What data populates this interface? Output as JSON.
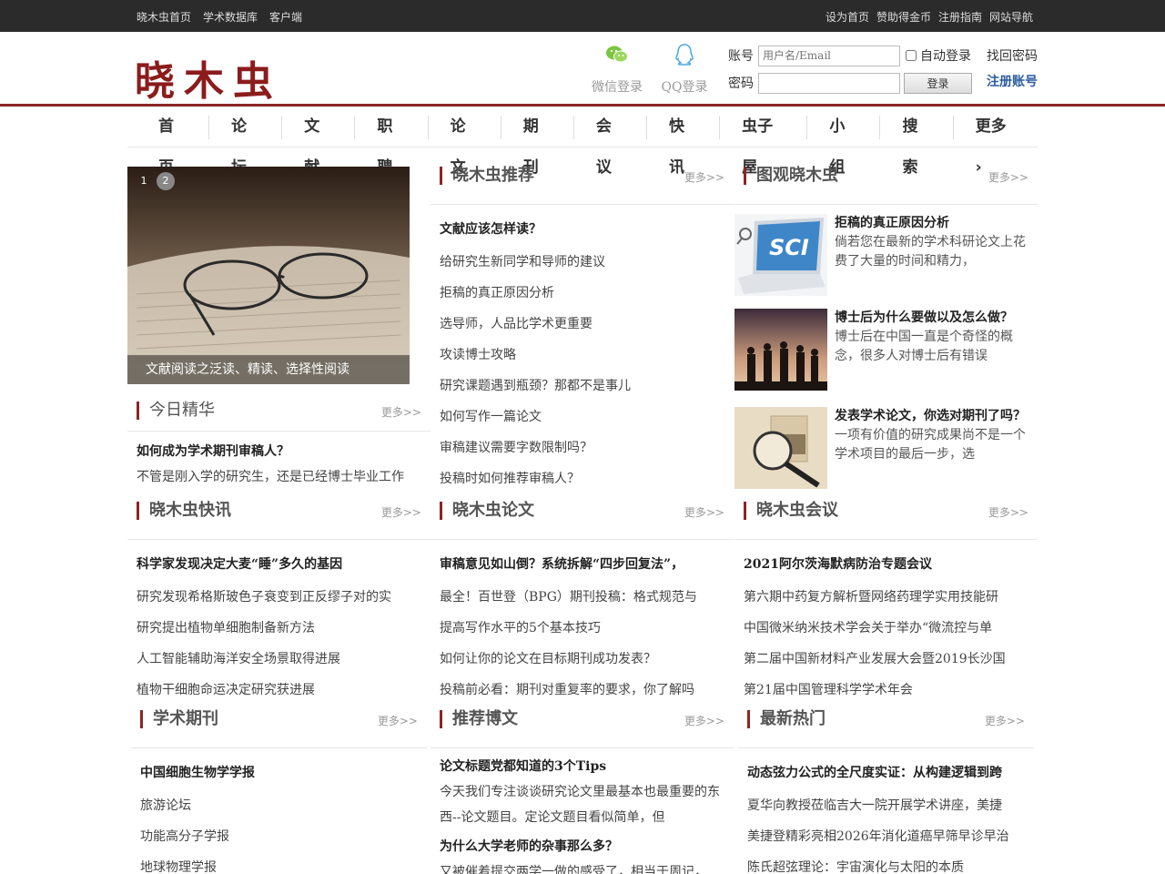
{
  "topbar": {
    "left": [
      "晓木虫首页",
      "学术数据库",
      "客户端"
    ],
    "right": [
      "设为首页",
      "赞助得金币",
      "注册指南",
      "网站导航"
    ]
  },
  "header": {
    "logo": "晓木虫",
    "wechat_label": "微信登录",
    "qq_label": "QQ登录",
    "account_label": "账号",
    "account_placeholder": "用户名/Email",
    "password_label": "密码",
    "auto_login": "自动登录",
    "login_button": "登录",
    "find_password": "找回密码",
    "register": "注册账号"
  },
  "nav": [
    "首页",
    "论坛",
    "文献",
    "职聘",
    "论文",
    "期刊",
    "会议",
    "快讯",
    "虫子屋",
    "小组",
    "搜索",
    "更多 ›"
  ],
  "slider": {
    "caption": "文献阅读之泛读、精读、选择性阅读",
    "dots": [
      "1",
      "2"
    ]
  },
  "more_label": "更多>>",
  "recommend": {
    "title": "晓木虫推荐",
    "items": [
      "文献应该怎样读？",
      "给研究生新同学和导师的建议",
      "拒稿的真正原因分析",
      "选导师，人品比学术更重要",
      "攻读博士攻略",
      "研究课题遇到瓶颈？那都不是事儿",
      "如何写作一篇论文",
      "审稿建议需要字数限制吗？",
      "投稿时如何推荐审稿人？"
    ]
  },
  "tuguan": {
    "title": "图观晓木虫",
    "items": [
      {
        "title": "拒稿的真正原因分析",
        "desc": "倘若您在最新的学术科研论文上花费了大量的时间和精力，",
        "icon": "laptop-sci-image"
      },
      {
        "title": "博士后为什么要做以及怎么做？",
        "desc": "博士后在中国一直是个奇怪的概念，很多人对博士后有错误",
        "icon": "graduates-silhouette-image"
      },
      {
        "title": "发表学术论文，你选对期刊了吗？",
        "desc": "一项有价值的研究成果尚不是一个学术项目的最后一步，选",
        "icon": "magnifier-stamps-image"
      }
    ]
  },
  "essence": {
    "title": "今日精华",
    "item_title": "如何成为学术期刊审稿人？",
    "item_desc": "不管是刚入学的研究生，还是已经博士毕业工作"
  },
  "news": {
    "title": "晓木虫快讯",
    "items": [
      "科学家发现决定大麦“睡”多久的基因",
      "研究发现希格斯玻色子衰变到正反缪子对的实",
      "研究提出植物单细胞制备新方法",
      "人工智能辅助海洋安全场景取得进展",
      "植物干细胞命运决定研究获进展"
    ]
  },
  "papers": {
    "title": "晓木虫论文",
    "items": [
      "审稿意见如山倒？系统拆解“四步回复法”，",
      "最全！百世登（BPG）期刊投稿：格式规范与",
      "提高写作水平的5个基本技巧",
      "如何让你的论文在目标期刊成功发表？",
      "投稿前必看：期刊对重复率的要求，你了解吗"
    ]
  },
  "meetings": {
    "title": "晓木虫会议",
    "items": [
      "2021阿尔茨海默病防治专题会议",
      "第六期中药复方解析暨网络药理学实用技能研",
      "中国微米纳米技术学会关于举办“微流控与单",
      "第二届中国新材料产业发展大会暨2019长沙国",
      "第21届中国管理科学学术年会"
    ]
  },
  "journals": {
    "title": "学术期刊",
    "items": [
      "中国细胞生物学学报",
      "旅游论坛",
      "功能高分子学报",
      "地球物理学报"
    ]
  },
  "blogs": {
    "title": "推荐博文",
    "b1_title": "论文标题党都知道的3个Tips",
    "b1_desc": "今天我们专注谈谈研究论文里最基本也最重要的东西--论文题目。定论文题目看似简单，但",
    "b2_title": "为什么大学老师的杂事那么多？",
    "b2_desc": "又被催着提交两学一做的感受了，相当于周记，"
  },
  "hot": {
    "title": "最新热门",
    "items": [
      "动态弦力公式的全尺度实证：从构建逻辑到跨",
      "夏华向教授莅临吉大一院开展学术讲座，美捷",
      "美捷登精彩亮相2026年消化道癌早筛早诊早治",
      "陈氏超弦理论：宇宙演化与太阳的本质"
    ]
  }
}
